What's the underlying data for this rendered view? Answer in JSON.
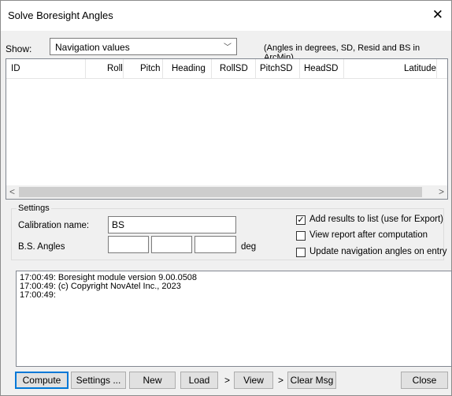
{
  "window": {
    "title": "Solve Boresight Angles",
    "close_glyph": "✕"
  },
  "show": {
    "label": "Show:",
    "selected": "Navigation values",
    "note": "(Angles in degrees, SD, Resid and BS in ArcMin)"
  },
  "table": {
    "columns": [
      "ID",
      "Roll",
      "Pitch",
      "Heading",
      "RollSD",
      "PitchSD",
      "HeadSD",
      "Latitude"
    ]
  },
  "settings": {
    "group_label": "Settings",
    "calibration_label": "Calibration name:",
    "calibration_value": "BS",
    "bs_angles_label": "B.S. Angles",
    "bs_angles_unit": "deg",
    "bs_angles_values": [
      "",
      "",
      ""
    ],
    "checkboxes": [
      {
        "label": "Add results to list (use for Export)",
        "checked": true
      },
      {
        "label": "View report after computation",
        "checked": false
      },
      {
        "label": "Update navigation angles on entry",
        "checked": false
      }
    ]
  },
  "messages": [
    "17:00:49: Boresight module version 9.00.0508",
    "17:00:49: (c) Copyright NovAtel Inc., 2023",
    "17:00:49:"
  ],
  "buttons": {
    "compute": "Compute",
    "settings": "Settings ...",
    "new": "New",
    "load": "Load",
    "view": "View",
    "clear_msg": "Clear Msg",
    "close": "Close",
    "more_glyph": ">"
  }
}
